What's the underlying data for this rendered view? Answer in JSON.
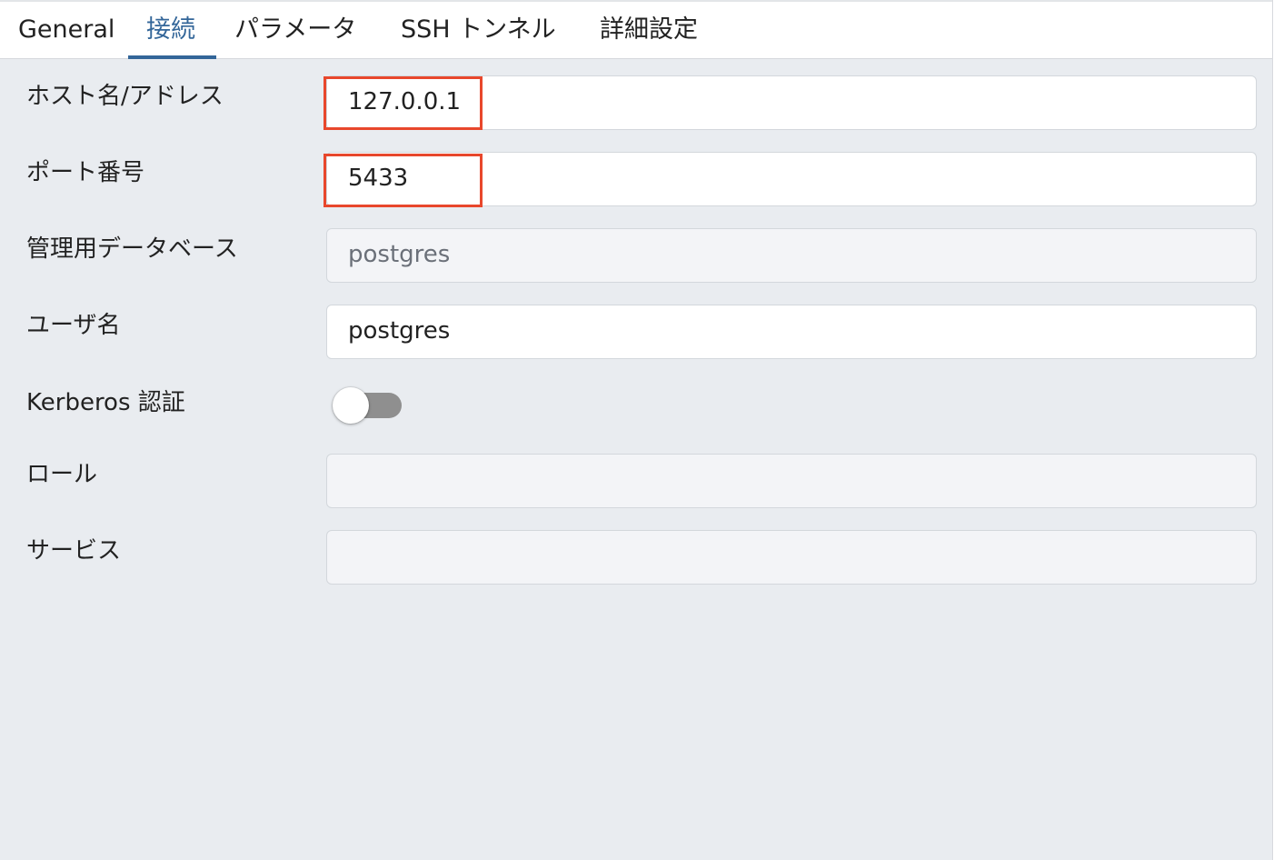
{
  "tabs": [
    {
      "label": "General"
    },
    {
      "label": "接続"
    },
    {
      "label": "パラメータ"
    },
    {
      "label": "SSH トンネル"
    },
    {
      "label": "詳細設定"
    }
  ],
  "active_tab": "接続",
  "form": {
    "host": {
      "label": "ホスト名/アドレス",
      "value": "127.0.0.1"
    },
    "port": {
      "label": "ポート番号",
      "value": "5433"
    },
    "maintenance_db": {
      "label": "管理用データベース",
      "value": "postgres"
    },
    "username": {
      "label": "ユーザ名",
      "value": "postgres"
    },
    "kerberos": {
      "label": "Kerberos 認証",
      "enabled": false
    },
    "role": {
      "label": "ロール",
      "value": ""
    },
    "service": {
      "label": "サービス",
      "value": ""
    }
  },
  "colors": {
    "accent": "#336699",
    "highlight_box": "#e8472c",
    "panel_background": "#e9ecf0"
  }
}
